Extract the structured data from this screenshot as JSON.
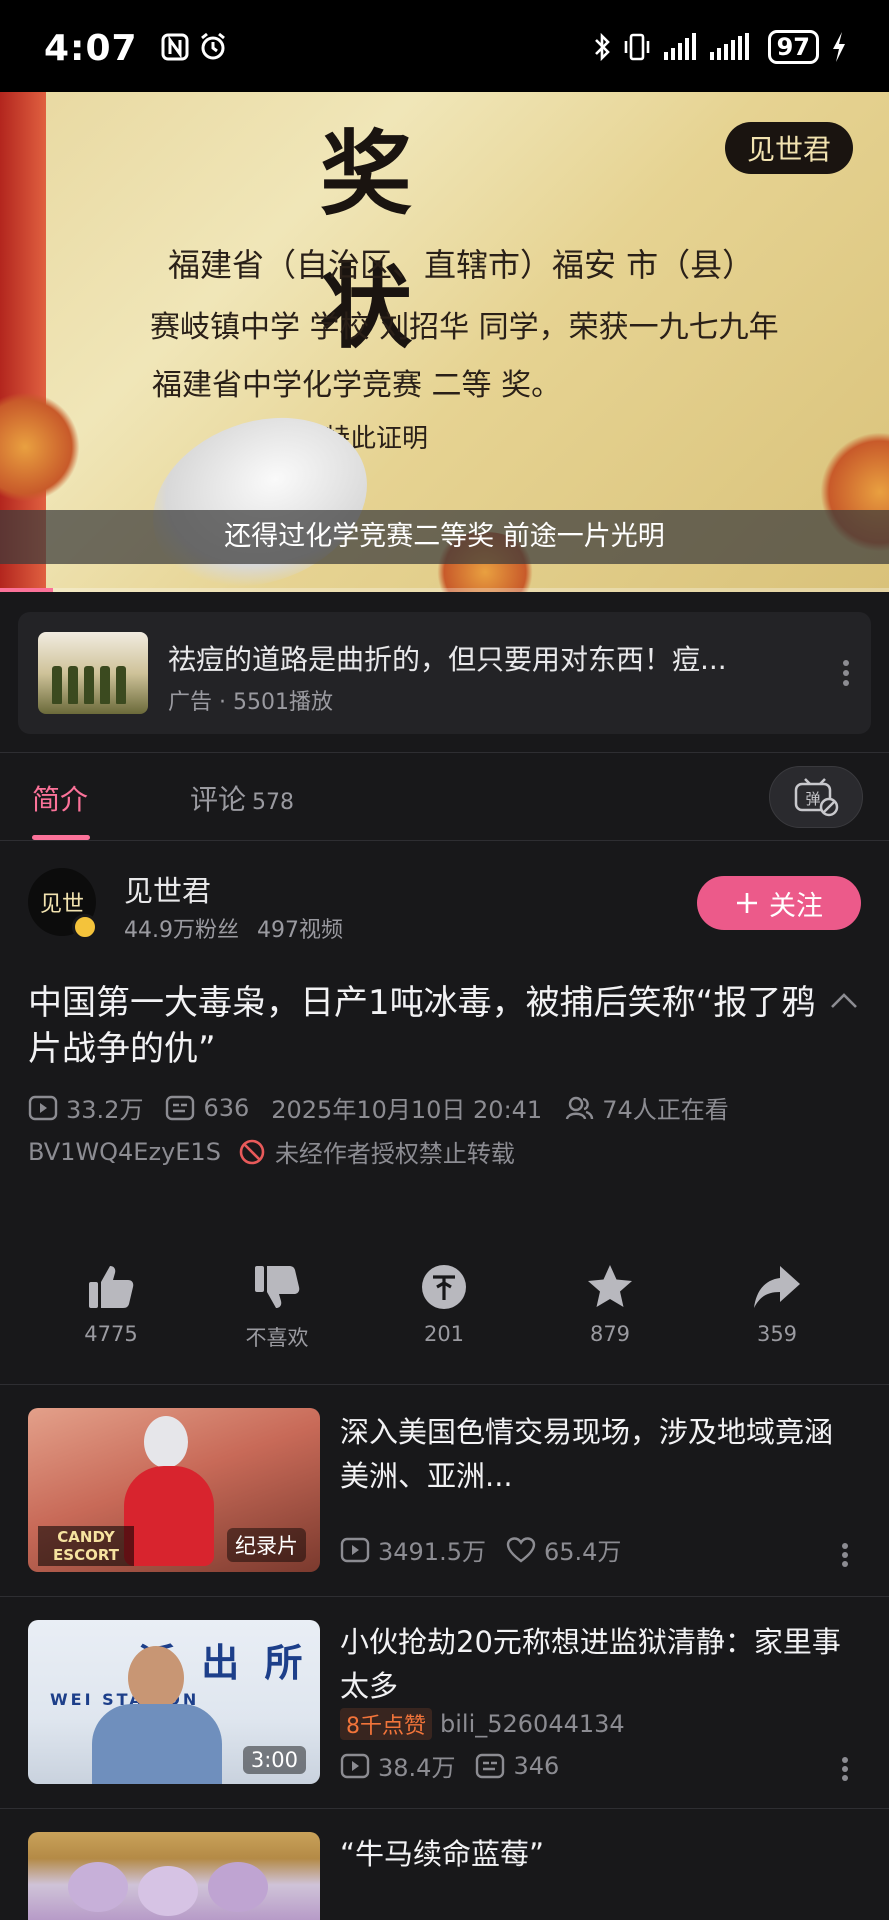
{
  "status_bar": {
    "time": "4:07",
    "battery": "97",
    "icons": [
      "nfc-icon",
      "alarm-icon",
      "bluetooth-icon",
      "vibrate-icon",
      "signal-icon",
      "signal-icon",
      "charging-icon"
    ]
  },
  "video": {
    "overlay_title": "奖 状",
    "channel_watermark": "见世君",
    "certificate_lines": [
      "福建省（自治区、直辖市）福安 市（县）",
      "赛岐镇中学 学校 刘招华 同学，荣获一九七九年",
      "福建省中学化学竞赛 二等 奖。",
      "特此证明"
    ],
    "subtitle": "还得过化学竞赛二等奖 前途一片光明",
    "progress_fraction": 0.06
  },
  "ad": {
    "title": "祛痘的道路是曲折的，但只要用对东西！痘...",
    "meta": "广告 · 5501播放"
  },
  "tabs": {
    "intro": "简介",
    "comments": "评论",
    "comments_count": "578"
  },
  "uploader": {
    "name": "见世君",
    "avatar_text": "见世",
    "fans": "44.9万粉丝",
    "videos": "497视频",
    "follow_label": "关注"
  },
  "video_info": {
    "title": "中国第一大毒枭，日产1吨冰毒，被捕后笑称“报了鸦片战争的仇”",
    "views": "33.2万",
    "danmaku": "636",
    "date": "2025年10月10日 20:41",
    "watching": "74人正在看",
    "bvid": "BV1WQ4EzyE1S",
    "repost_notice": "未经作者授权禁止转载"
  },
  "actions": {
    "like": "4775",
    "dislike": "不喜欢",
    "coin": "201",
    "favorite": "879",
    "share": "359"
  },
  "recommendations": [
    {
      "title": "深入美国色情交易现场，涉及地域竟涵美洲、亚洲...",
      "badge": "纪录片",
      "thumb_text": "CANDY ESCORT",
      "views": "3491.5万",
      "likes": "65.4万"
    },
    {
      "title": "小伙抢劫20元称想进监狱清静：家里事太多",
      "duration": "3:00",
      "hot_tag": "8千点赞",
      "author": "bili_526044134",
      "views": "38.4万",
      "danmaku": "346",
      "thumb_sign": "派 出 所",
      "thumb_sign_en": "WEI STATION"
    },
    {
      "title": "“牛马续命蓝莓”"
    }
  ],
  "colors": {
    "accent": "#fb7299",
    "follow_button": "#ec5a8a",
    "background": "#18181a",
    "hot_tag": "#f2743a"
  }
}
